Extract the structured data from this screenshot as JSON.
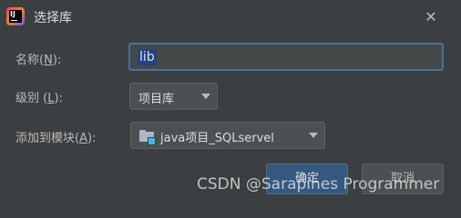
{
  "dialog": {
    "title": "选择库",
    "close_glyph": "✕",
    "app_icon_text": "IJ"
  },
  "form": {
    "name_label_pre": "名称(",
    "name_label_key": "N",
    "name_label_post": "):",
    "name_value": "lib",
    "level_label_pre": "级别 (",
    "level_label_key": "L",
    "level_label_post": "):",
    "level_value": "项目库",
    "module_label_pre": "添加到模块(",
    "module_label_key": "A",
    "module_label_post": "):",
    "module_value": "java项目_SQLservel"
  },
  "buttons": {
    "ok": "确定",
    "cancel": "取消"
  },
  "watermark": "CSDN @Sarapines Programmer",
  "colors": {
    "background": "#3c3f41",
    "input_border": "#4e7094",
    "selection": "#214283",
    "ok_button": "#365880"
  },
  "icons": {
    "app": "intellij-idea-icon",
    "close": "close-icon",
    "module": "module-folder-icon",
    "dropdown": "chevron-down-icon"
  }
}
